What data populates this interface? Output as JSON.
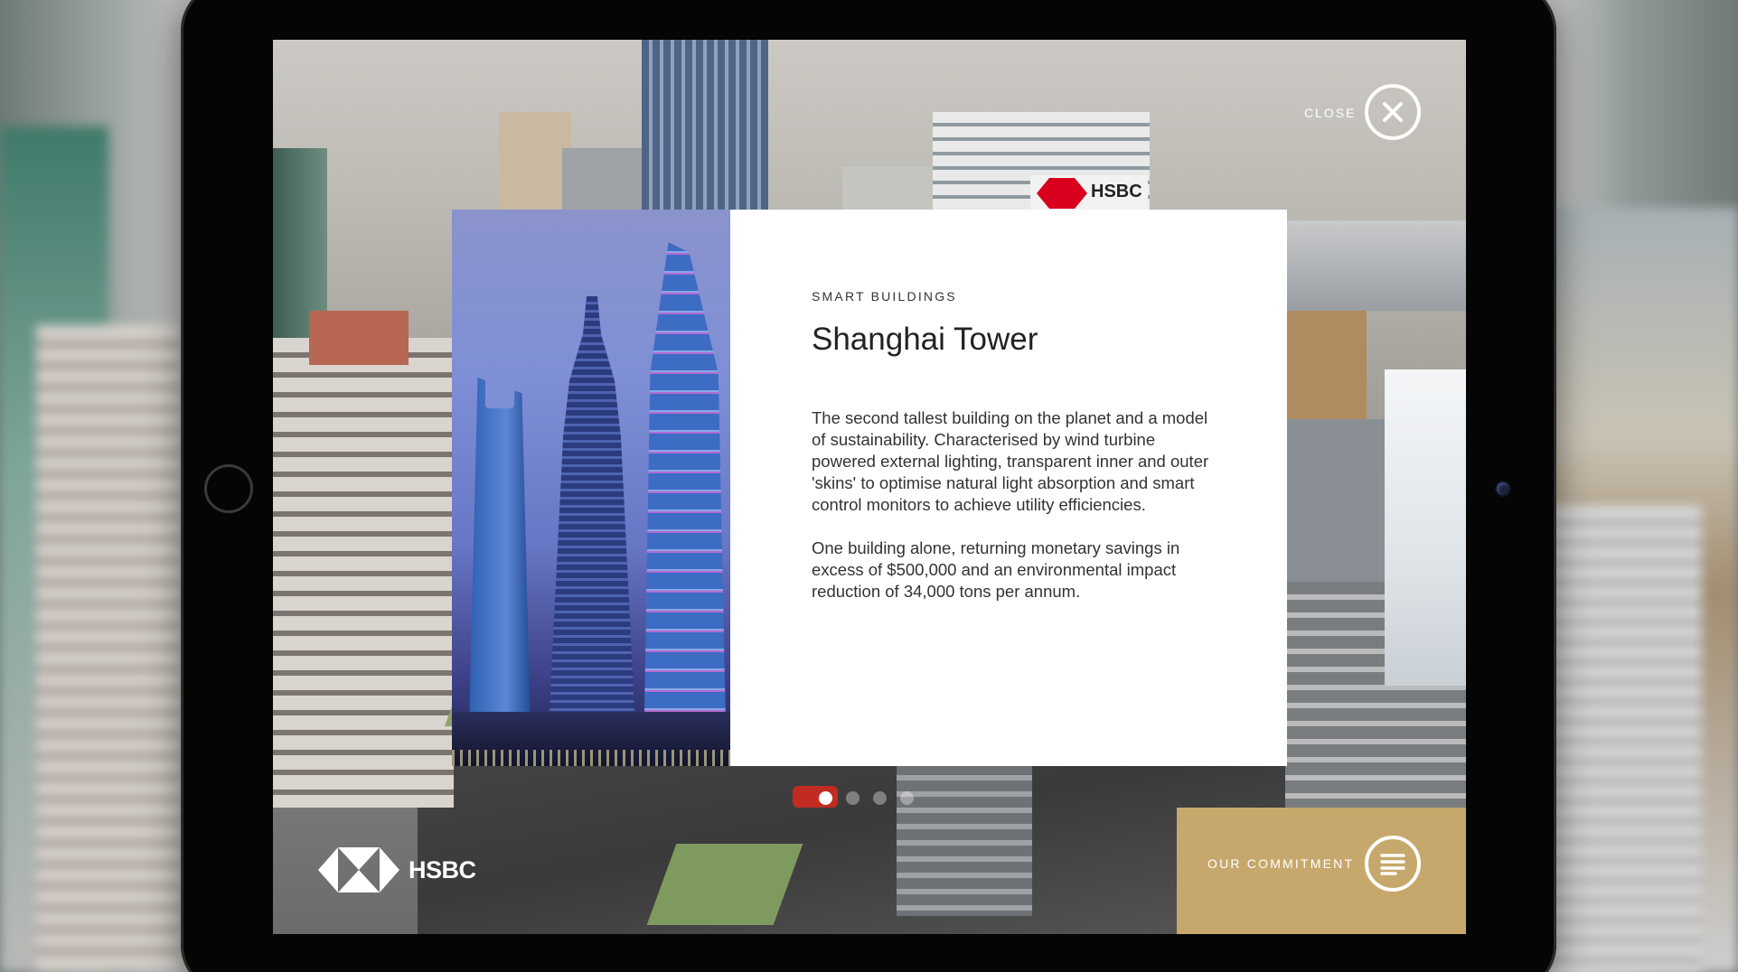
{
  "header": {
    "close_label": "CLOSE"
  },
  "card": {
    "eyebrow": "SMART BUILDINGS",
    "title": "Shanghai Tower",
    "paragraph_1": "The second tallest building on the planet and a model of sustainability. Characterised by wind turbine powered external lighting, transparent inner and outer 'skins' to optimise natural light absorption and smart control monitors to achieve utility efficiencies.",
    "paragraph_2": "One building alone, returning monetary savings in excess of $500,000 and an environmental impact reduction of 34,000 tons per annum."
  },
  "pagination": {
    "total": 4,
    "active_index": 0
  },
  "footer": {
    "logo_text": "HSBC",
    "commitment_label": "OUR COMMITMENT"
  },
  "scene": {
    "sign_text": "HSBC"
  },
  "icons": {
    "close": "close-icon",
    "menu": "menu-icon",
    "logo": "hsbc-hexagon-logo"
  },
  "colors": {
    "brand_red": "#DB0011",
    "card_bg": "#FFFFFF",
    "text_primary": "#222222",
    "overlay_white": "#FFFFFF"
  }
}
